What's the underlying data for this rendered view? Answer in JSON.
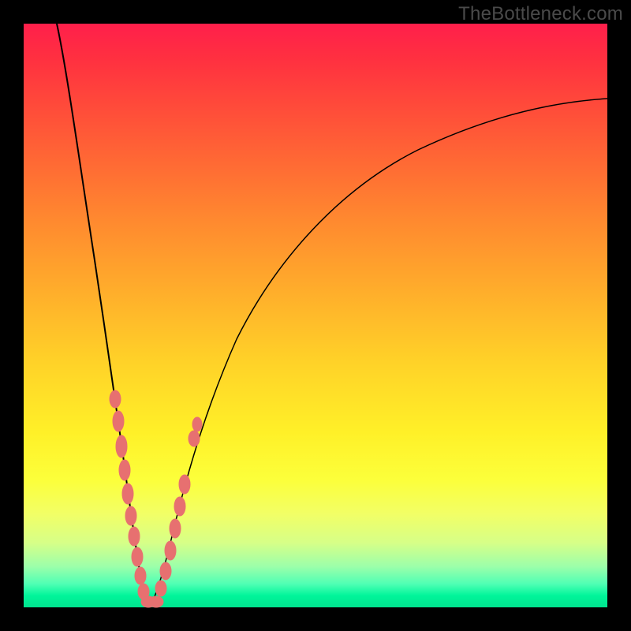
{
  "watermark": "TheBottleneck.com",
  "colors": {
    "background_black": "#000000",
    "gradient_top": "#ff1f4b",
    "gradient_bottom": "#00e48f",
    "curve_stroke": "#000000",
    "marker_color": "#e77070",
    "watermark_text": "#4a4a4a"
  },
  "chart_data": {
    "type": "line",
    "title": "",
    "xlabel": "",
    "ylabel": "",
    "xlim": [
      0,
      100
    ],
    "ylim": [
      0,
      100
    ],
    "grid": false,
    "legend": false,
    "note": "V-shaped bottleneck curve. x is relative component driver (0–100 across plot width), y is bottleneck magnitude (0 at bottom/green = no bottleneck, 100 at top/red = severe). Minimum around x≈21 where curve touches 0. Values estimated from pixel positions; no axis ticks present.",
    "series": [
      {
        "name": "bottleneck_curve",
        "x": [
          0,
          4,
          8,
          12,
          14,
          16,
          18,
          20,
          21,
          22,
          23,
          24,
          26,
          28,
          30,
          34,
          38,
          44,
          52,
          62,
          74,
          88,
          100
        ],
        "values": [
          100,
          86,
          70,
          50,
          39,
          27,
          15,
          4,
          0,
          0,
          2,
          6,
          14,
          22,
          29,
          40,
          48,
          57,
          65,
          72,
          78,
          82,
          85
        ]
      }
    ],
    "markers": {
      "name": "highlighted_points",
      "note": "Salmon dot clusters near the V-bottom on both branches (approximate positions, values match curve).",
      "x": [
        14.5,
        15.5,
        16.5,
        17.0,
        17.8,
        18.5,
        19.0,
        19.5,
        20.0,
        20.5,
        21.0,
        21.5,
        22.0,
        22.5,
        23.0,
        23.8,
        24.5,
        25.2,
        26.0,
        27.5
      ],
      "values": [
        36,
        31,
        26,
        23,
        19,
        14,
        11,
        8,
        5,
        2,
        0.5,
        0.5,
        1,
        2,
        3.5,
        6,
        8,
        10.5,
        13,
        20
      ]
    }
  }
}
